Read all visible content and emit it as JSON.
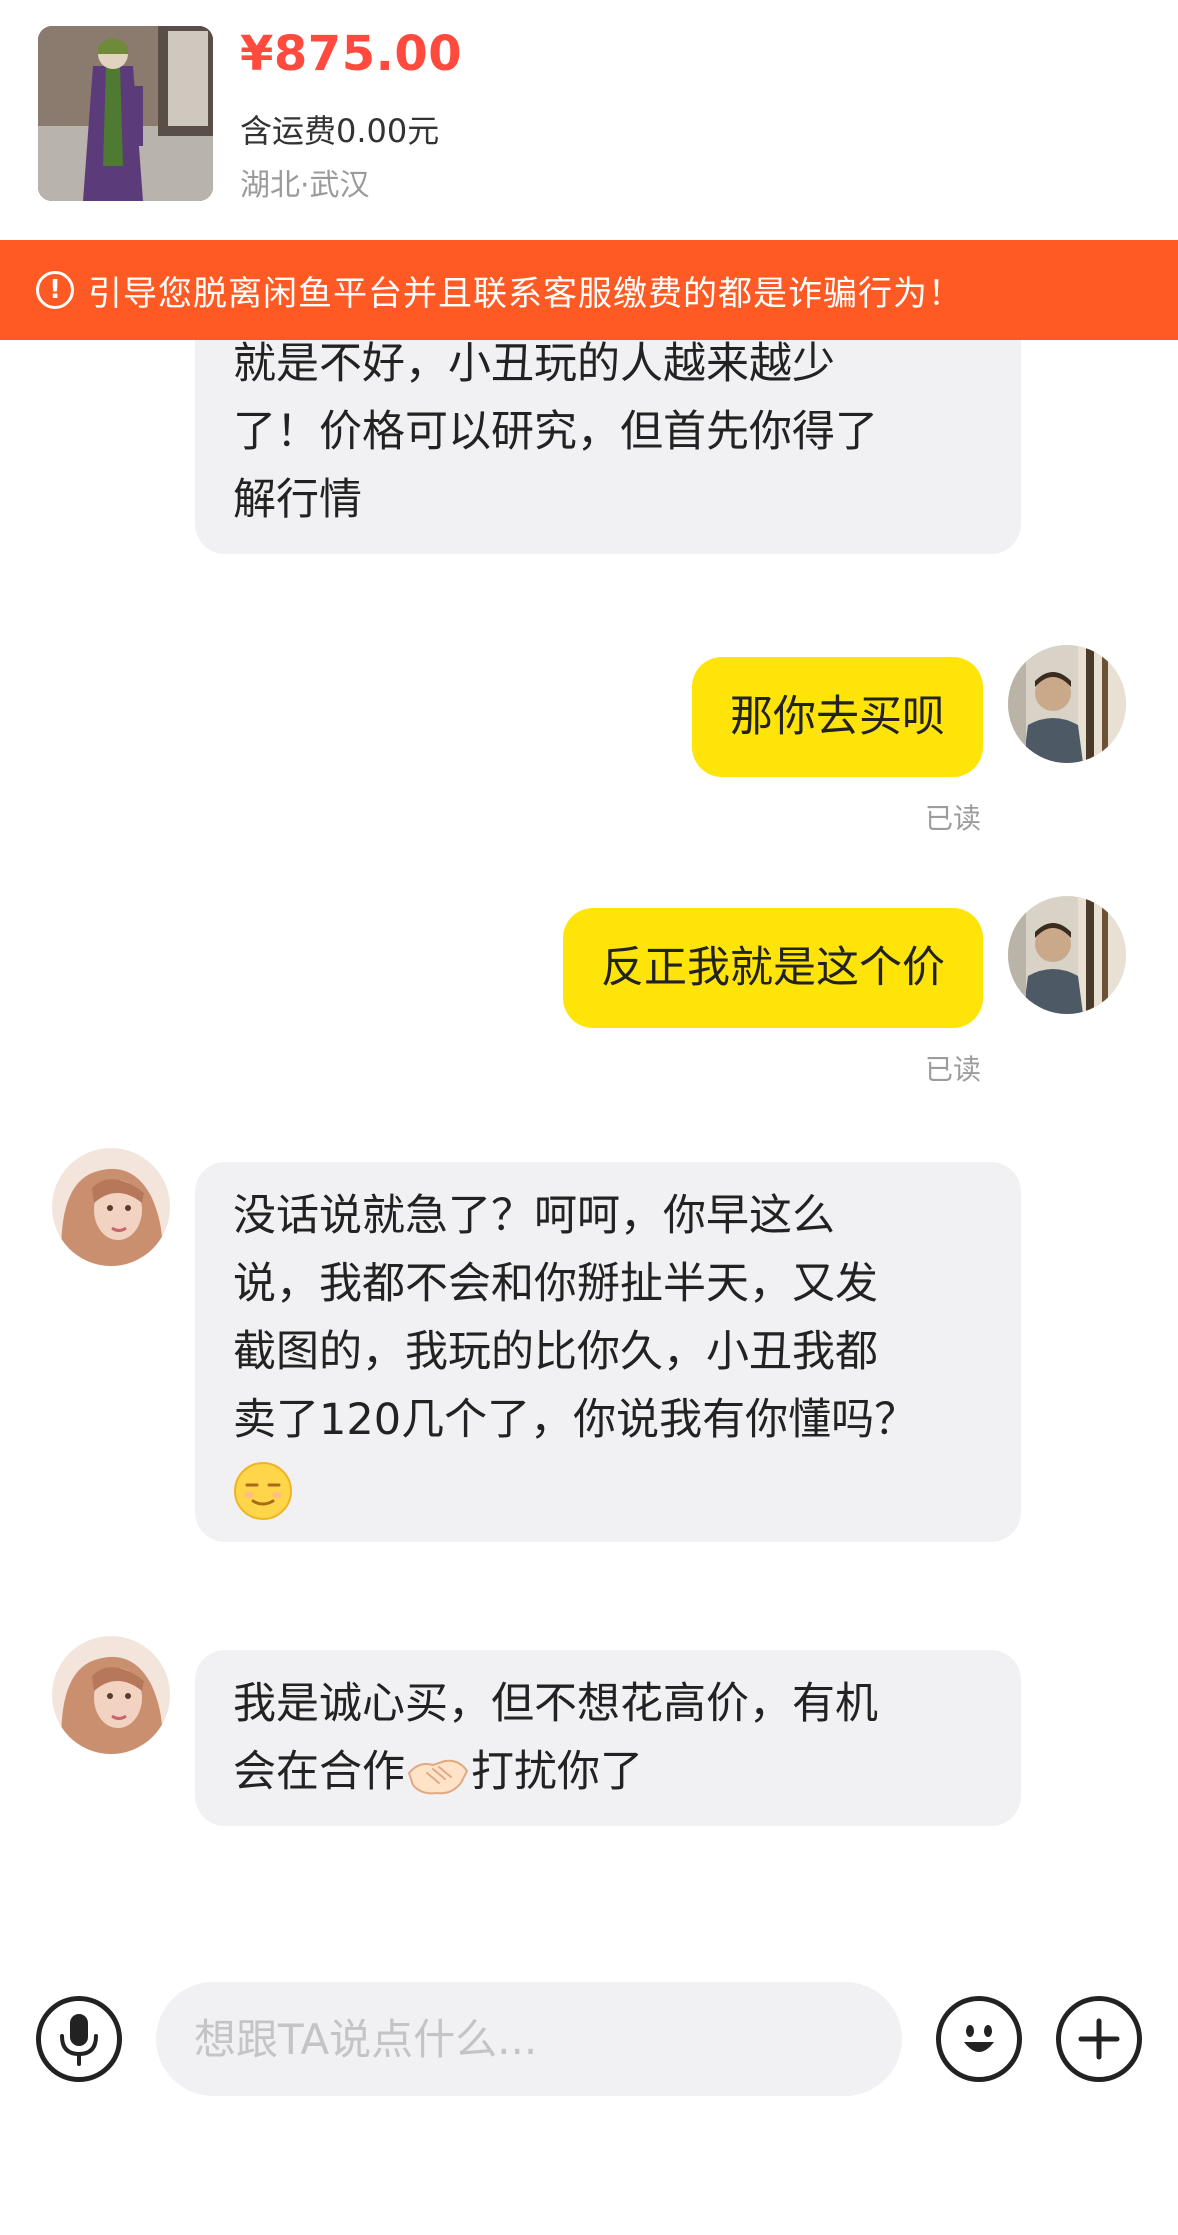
{
  "product": {
    "price": "¥875.00",
    "shipping": "含运费0.00元",
    "location": "湖北·武汉"
  },
  "warning": {
    "icon": "exclamation-circle-icon",
    "text": "引导您脱离闲鱼平台并且联系客服缴费的都是诈骗行为！"
  },
  "messages": [
    {
      "sender": "other",
      "lines": [
        "就是不好，小丑玩的人越来越少",
        "了！价格可以研究，但首先你得了",
        "解行情"
      ]
    },
    {
      "sender": "me",
      "text": "那你去买呗",
      "status": "已读"
    },
    {
      "sender": "me",
      "text": "反正我就是这个价",
      "status": "已读"
    },
    {
      "sender": "other",
      "lines": [
        "没话说就急了？呵呵，你早这么",
        "说，我都不会和你掰扯半天，又发",
        "截图的，我玩的比你久，小丑我都",
        "卖了120几个了，你说我有你懂吗？"
      ],
      "emoji": "smirk-emoji"
    },
    {
      "sender": "other",
      "line1": "我是诚心买，但不想花高价，有机",
      "line2_before": "会在合作",
      "emoji": "handshake-emoji",
      "line2_after": "打扰你了"
    }
  ],
  "input_bar": {
    "placeholder": "想跟TA说点什么...",
    "icons": [
      "microphone-icon",
      "smiley-icon",
      "plus-icon"
    ]
  },
  "colors": {
    "price": "#ff4a3d",
    "warning_bg": "#ff5a23",
    "my_bubble": "#ffe40a",
    "their_bubble": "#f1f1f3"
  }
}
